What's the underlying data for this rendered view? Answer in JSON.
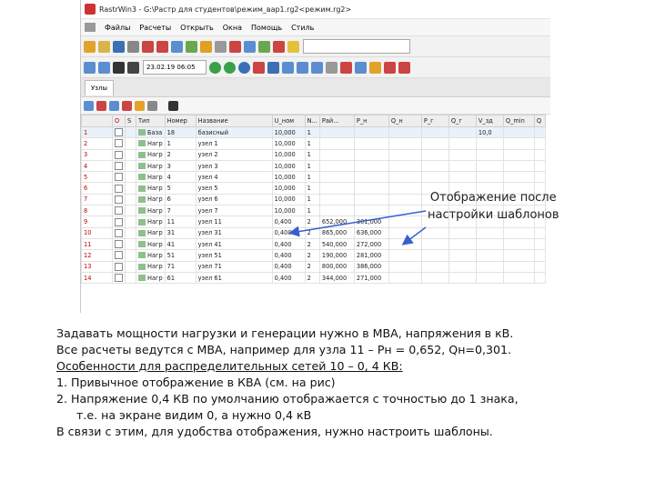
{
  "window": {
    "title": "RastrWin3 - G:\\Растр для студентов\\режим_вар1.rg2<режим.rg2>"
  },
  "menu": [
    "Файлы",
    "Расчеты",
    "Открыть",
    "Окна",
    "Помощь",
    "Стиль"
  ],
  "toolbar": {
    "date": "23.02.19",
    "time": "06:05"
  },
  "tab": {
    "label": "Узлы"
  },
  "table": {
    "columns": [
      "",
      "О",
      "S",
      "Тип",
      "Номер",
      "Название",
      "U_ном",
      "N...",
      "Рай...",
      "P_н",
      "Q_н",
      "P_г",
      "Q_г",
      "V_зд",
      "Q_min",
      "Q"
    ],
    "rows": [
      [
        "1",
        "",
        "",
        "База",
        "18",
        "базисный",
        "10,000",
        "1",
        "",
        "",
        "",
        "",
        "",
        "10,0",
        "",
        ""
      ],
      [
        "2",
        "",
        "",
        "Нагр",
        "1",
        "узел 1",
        "10,000",
        "1",
        "",
        "",
        "",
        "",
        "",
        "",
        "",
        ""
      ],
      [
        "3",
        "",
        "",
        "Нагр",
        "2",
        "узел 2",
        "10,000",
        "1",
        "",
        "",
        "",
        "",
        "",
        "",
        "",
        ""
      ],
      [
        "4",
        "",
        "",
        "Нагр",
        "3",
        "узел 3",
        "10,000",
        "1",
        "",
        "",
        "",
        "",
        "",
        "",
        "",
        ""
      ],
      [
        "5",
        "",
        "",
        "Нагр",
        "4",
        "узел 4",
        "10,000",
        "1",
        "",
        "",
        "",
        "",
        "",
        "",
        "",
        ""
      ],
      [
        "6",
        "",
        "",
        "Нагр",
        "5",
        "узел 5",
        "10,000",
        "1",
        "",
        "",
        "",
        "",
        "",
        "",
        "",
        ""
      ],
      [
        "7",
        "",
        "",
        "Нагр",
        "6",
        "узел 6",
        "10,000",
        "1",
        "",
        "",
        "",
        "",
        "",
        "",
        "",
        ""
      ],
      [
        "8",
        "",
        "",
        "Нагр",
        "7",
        "узел 7",
        "10,000",
        "1",
        "",
        "",
        "",
        "",
        "",
        "",
        "",
        ""
      ],
      [
        "9",
        "",
        "",
        "Нагр",
        "11",
        "узел 11",
        "0,400",
        "2",
        "652,000",
        "301,000",
        "",
        "",
        "",
        "",
        "",
        ""
      ],
      [
        "10",
        "",
        "",
        "Нагр",
        "31",
        "узел 31",
        "0,400",
        "2",
        "865,000",
        "636,000",
        "",
        "",
        "",
        "",
        "",
        ""
      ],
      [
        "11",
        "",
        "",
        "Нагр",
        "41",
        "узел 41",
        "0,400",
        "2",
        "540,000",
        "272,000",
        "",
        "",
        "",
        "",
        "",
        ""
      ],
      [
        "12",
        "",
        "",
        "Нагр",
        "51",
        "узел 51",
        "0,400",
        "2",
        "190,000",
        "281,000",
        "",
        "",
        "",
        "",
        "",
        ""
      ],
      [
        "13",
        "",
        "",
        "Нагр",
        "71",
        "узел 71",
        "0,400",
        "2",
        "800,000",
        "386,000",
        "",
        "",
        "",
        "",
        "",
        ""
      ],
      [
        "14",
        "",
        "",
        "Нагр",
        "61",
        "узел 61",
        "0,400",
        "2",
        "344,000",
        "271,000",
        "",
        "",
        "",
        "",
        "",
        ""
      ]
    ]
  },
  "callout": {
    "line1": "Отображение после",
    "line2": "настройки шаблонов"
  },
  "text": {
    "p1": "Задавать мощности нагрузки и генерации нужно в МВА, напряжения в кВ.",
    "p2": "Все расчеты ведутся с МВА, например для узла 11 – Рн = 0,652, Qн=0,301.",
    "p3": "Особенности для распределительных сетей 10 – 0, 4 КВ:",
    "p4": "1.  Привычное отображение в КВА (см. на рис)",
    "p5": "2.   Напряжение 0,4 КВ по умолчанию отображается с точностью до 1 знака,",
    "p6": "т.е. на экране видим 0, а нужно 0,4 кВ",
    "p7": "В связи с этим, для удобства отображения, нужно настроить шаблоны."
  },
  "colors": {
    "accent_red": "#c00000",
    "arrow": "#3a5fcd"
  }
}
